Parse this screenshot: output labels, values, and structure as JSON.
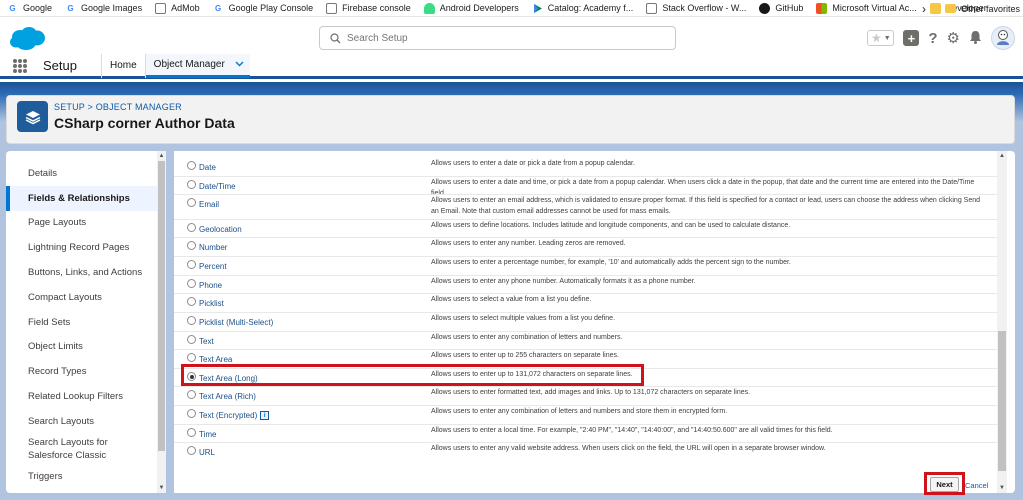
{
  "bookmarks": {
    "items": [
      {
        "label": "Google",
        "icon": "google-g-icon"
      },
      {
        "label": "Google Images",
        "icon": "google-g-icon"
      },
      {
        "label": "AdMob",
        "icon": "page-icon"
      },
      {
        "label": "Google Play Console",
        "icon": "google-g-icon"
      },
      {
        "label": "Firebase console",
        "icon": "page-icon"
      },
      {
        "label": "Android Developers",
        "icon": "android-icon"
      },
      {
        "label": "Catalog: Academy f...",
        "icon": "play-icon"
      },
      {
        "label": "Stack Overflow - W...",
        "icon": "page-icon"
      },
      {
        "label": "GitHub",
        "icon": "github-icon"
      },
      {
        "label": "Microsoft Virtual Ac...",
        "icon": "microsoft-icon"
      },
      {
        "label": "Developer",
        "icon": "folder-icon"
      }
    ],
    "more": "›",
    "other_favorites": "Other favorites"
  },
  "header": {
    "search_placeholder": "Search Setup"
  },
  "app_nav": {
    "app_name": "Setup",
    "tabs": [
      {
        "label": "Home",
        "active": false
      },
      {
        "label": "Object Manager",
        "active": true
      }
    ]
  },
  "page_header": {
    "crumb_setup": "SETUP",
    "crumb_sep": " > ",
    "crumb_object_manager": "OBJECT MANAGER",
    "title": "CSharp corner Author Data"
  },
  "sidebar": {
    "items": [
      {
        "label": "Details",
        "active": false
      },
      {
        "label": "Fields & Relationships",
        "active": true
      },
      {
        "label": "Page Layouts",
        "active": false
      },
      {
        "label": "Lightning Record Pages",
        "active": false
      },
      {
        "label": "Buttons, Links, and Actions",
        "active": false
      },
      {
        "label": "Compact Layouts",
        "active": false
      },
      {
        "label": "Field Sets",
        "active": false
      },
      {
        "label": "Object Limits",
        "active": false
      },
      {
        "label": "Record Types",
        "active": false
      },
      {
        "label": "Related Lookup Filters",
        "active": false
      },
      {
        "label": "Search Layouts",
        "active": false
      },
      {
        "label": "Search Layouts for Salesforce Classic",
        "active": false
      },
      {
        "label": "Triggers",
        "active": false
      }
    ]
  },
  "field_types": [
    {
      "label": "Date",
      "selected": false,
      "description": "Allows users to enter a date or pick a date from a popup calendar."
    },
    {
      "label": "Date/Time",
      "selected": false,
      "description": "Allows users to enter a date and time, or pick a date from a popup calendar. When users click a date in the popup, that date and the current time are entered into the Date/Time field."
    },
    {
      "label": "Email",
      "selected": false,
      "description": "Allows users to enter an email address, which is validated to ensure proper format. If this field is specified for a contact or lead, users can choose the address when clicking Send an Email. Note that custom email addresses cannot be used for mass emails."
    },
    {
      "label": "Geolocation",
      "selected": false,
      "description": "Allows users to define locations. Includes latitude and longitude components, and can be used to calculate distance."
    },
    {
      "label": "Number",
      "selected": false,
      "description": "Allows users to enter any number. Leading zeros are removed."
    },
    {
      "label": "Percent",
      "selected": false,
      "description": "Allows users to enter a percentage number, for example, '10' and automatically adds the percent sign to the number."
    },
    {
      "label": "Phone",
      "selected": false,
      "description": "Allows users to enter any phone number. Automatically formats it as a phone number."
    },
    {
      "label": "Picklist",
      "selected": false,
      "description": "Allows users to select a value from a list you define."
    },
    {
      "label": "Picklist (Multi-Select)",
      "selected": false,
      "description": "Allows users to select multiple values from a list you define."
    },
    {
      "label": "Text",
      "selected": false,
      "description": "Allows users to enter any combination of letters and numbers."
    },
    {
      "label": "Text Area",
      "selected": false,
      "description": "Allows users to enter up to 255 characters on separate lines."
    },
    {
      "label": "Text Area (Long)",
      "selected": true,
      "description": "Allows users to enter up to 131,072 characters on separate lines."
    },
    {
      "label": "Text Area (Rich)",
      "selected": false,
      "description": "Allows users to enter formatted text, add images and links. Up to 131,072 characters on separate lines."
    },
    {
      "label": "Text (Encrypted)",
      "selected": false,
      "info_icon": true,
      "description": "Allows users to enter any combination of letters and numbers and store them in encrypted form."
    },
    {
      "label": "Time",
      "selected": false,
      "description": "Allows users to enter a local time. For example, \"2:40 PM\", \"14:40\", \"14:40:00\", and \"14:40:50.600\" are all valid times for this field."
    },
    {
      "label": "URL",
      "selected": false,
      "description": "Allows users to enter any valid website address. When users click on the field, the URL will open in a separate browser window."
    }
  ],
  "footer": {
    "next_label": "Next",
    "cancel_label": "Cancel"
  },
  "colors": {
    "brand_blue": "#1b5297",
    "link_blue": "#0b5cab",
    "highlight_red": "#d0121b"
  }
}
